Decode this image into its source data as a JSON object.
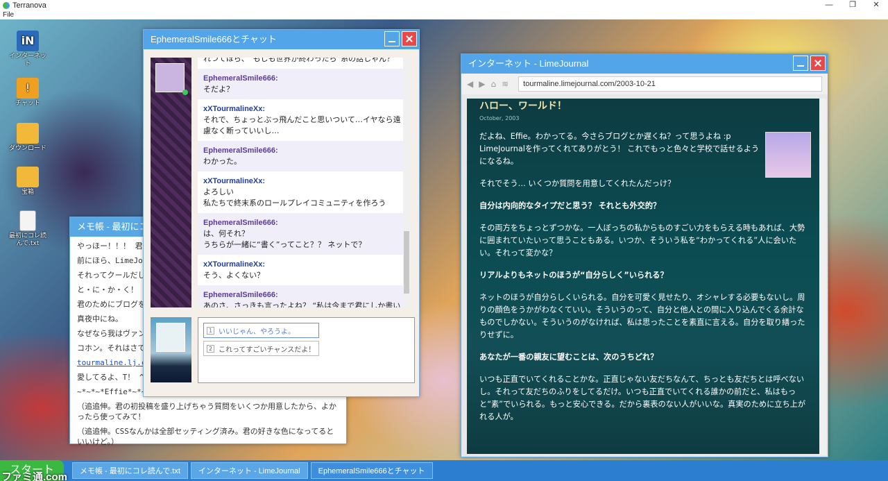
{
  "app": {
    "title": "Terranova",
    "menu_file": "File"
  },
  "desktop_icons": [
    {
      "label": "インターネット",
      "icon": "internet-icon"
    },
    {
      "label": "チャット",
      "icon": "chat-icon"
    },
    {
      "label": "ダウンロード",
      "icon": "folder-icon"
    },
    {
      "label": "宝箱",
      "icon": "folder-icon"
    },
    {
      "label": "最初にコレ読んで.txt",
      "icon": "text-file-icon"
    }
  ],
  "notepad": {
    "title": "メモ帳 - 最初にコレ読んで.txt",
    "lines": [
      "やっほー！！！ 君の",
      "前にほら、LimeJour",
      "それってクールだし",
      "と・に・か・く！",
      "君のためにブログを",
      "真夜中にね。",
      "なぜなら我はヴァン",
      "コホン。それはさて",
      "tourmaline.lj.com",
      "愛してるよ、T！ ^_",
      "~*~*~*Effie*~*~*"
    ],
    "para1": "（追追伸。君の初投稿を盛り上げちゃう質問をいくつか用意したから、よかったら使ってみて！",
    "para2": "（追追伸。CSSなんかは全部セッティング済み。君の好きな色になってるといいけど。）"
  },
  "chat": {
    "title": "EphemeralSmile666とチャット",
    "messages": [
      {
        "who": "",
        "text": "れつてほら、“もしも世界が終わったら”系の話しゃん？",
        "me": false
      },
      {
        "who": "EphemeralSmile666:",
        "text": "そだよ？",
        "me": true
      },
      {
        "who": "xXTourmalineXx:",
        "text": "それで、ちょっとぶっ飛んだこと思いついて…イヤなら遠慮なく断っていいし…",
        "me": false
      },
      {
        "who": "EphemeralSmile666:",
        "text": "わかった。",
        "me": true
      },
      {
        "who": "xXTourmalineXx:",
        "text": "よろしい\n私たちで終末系のロールプレイコミュニティを作ろう",
        "me": false
      },
      {
        "who": "EphemeralSmile666:",
        "text": "は、何それ？\nうちらが一緒に“書く”ってこと？？ ネットで？",
        "me": true
      },
      {
        "who": "xXTourmalineXx:",
        "text": "そう、よくない？",
        "me": false
      },
      {
        "who": "EphemeralSmile666:",
        "text": "あのさ、さっきも言ったよね？ “私は今まで君にしか書いたものを見せたことがない”んだよ？",
        "me": true
      }
    ],
    "choices": [
      {
        "num": "1",
        "text": "いいじゃん、やろうよ。"
      },
      {
        "num": "2",
        "text": "これってすごいチャンスだよ！"
      }
    ]
  },
  "browser": {
    "title": "インターネット - LimeJournal",
    "url": "tourmaline.limejournal.com/2003-10-21",
    "post_title": "ハロー、ワールド！",
    "post_date": "October, 2003",
    "paragraphs": [
      {
        "q": false,
        "text": "だよね、Effie。わかってる。今さらブログとか遅くね？って思うよね :p LimeJournalを作ってくれてありがとう！ これでもっと色々と学校で話せるようになるね。"
      },
      {
        "q": false,
        "text": "それでそう… いくつか質問を用意してくれたんだっけ？"
      },
      {
        "q": true,
        "text": "自分は内向的なタイプだと思う？ それとも外交的？"
      },
      {
        "q": false,
        "text": "その両方をちょっとずつかな。一人ぼっちの私からものすごい力をもらえる時もあれば、大勢に囲まれていたいって思うこともある。いつか、そういう私を“わかってくれる”人に会いたい。それって変かな？"
      },
      {
        "q": true,
        "text": "リアルよりもネットのほうが“自分らしく”いられる？"
      },
      {
        "q": false,
        "text": "ネットのほうが自分らしくいられる。自分を可愛く見せたり、オシャレする必要もないし。周りの顔色をうかがわなくていい。そういうのって、自分と他人との間に入り込んでくる余計なものでしかない。そういうのがなければ、私は思ったことを素直に言える。自分を取り繕ったりせずに。"
      },
      {
        "q": true,
        "text": "あなたが一番の親友に望むことは、次のうちどれ？"
      },
      {
        "q": false,
        "text": "いつも正直でいてくれることかな。正直じゃない友だちなんて、ちっとも友だちとは呼べないし。それって友だちのふりをしてるだけ。いつも正直でいてくれる誰かの前だと、私はもっと“素”でいられる。もっと安心できる。だから裏表のない人がいいな。真実のために立ち上がれる人が。"
      }
    ]
  },
  "taskbar": {
    "start": "スタート",
    "items": [
      "メモ帳 - 最初にコレ読んで.txt",
      "インターネット - LimeJournal",
      "EphemeralSmile666とチャット"
    ]
  },
  "watermark": "ファミ通.com",
  "colors": {
    "title_bar": "#52a5e8",
    "close": "#e84848",
    "taskbar": "#2c7fd0",
    "start": "#3ab840"
  }
}
